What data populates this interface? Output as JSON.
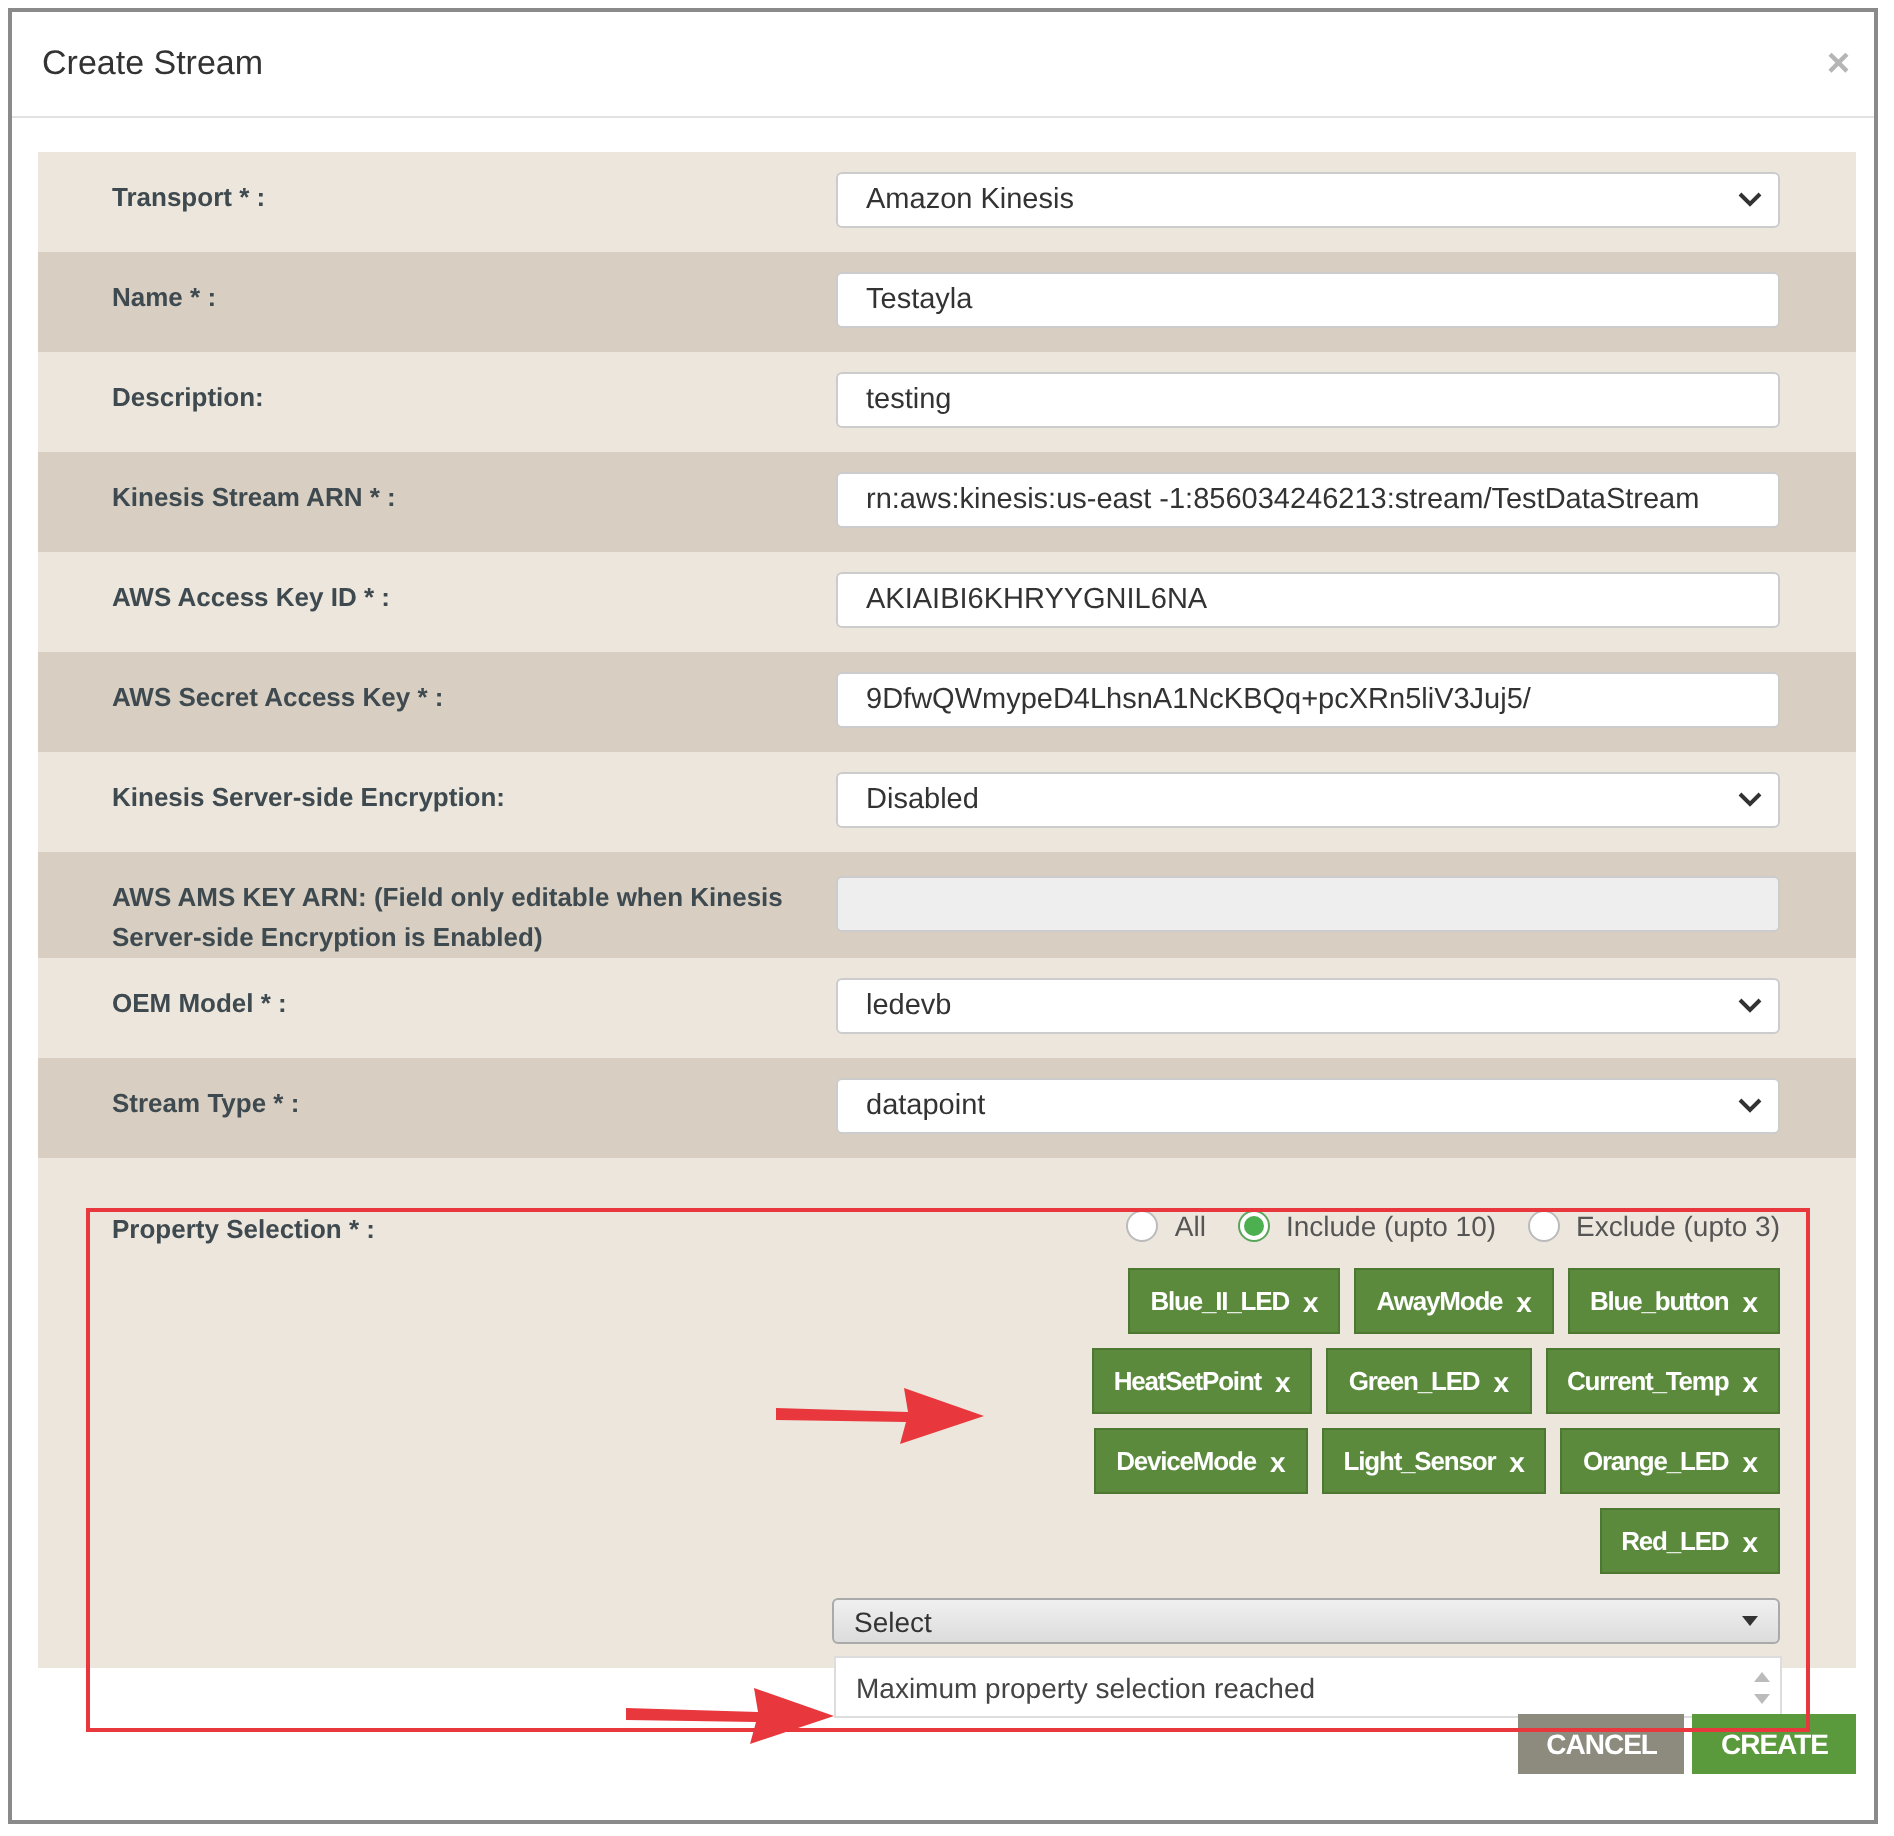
{
  "dialog": {
    "title": "Create Stream",
    "close": "×"
  },
  "fields": [
    {
      "label": "Transport * :",
      "kind": "select",
      "value": "Amazon Kinesis"
    },
    {
      "label": "Name * :",
      "kind": "text",
      "value": "Testayla"
    },
    {
      "label": "Description:",
      "kind": "text",
      "value": "testing"
    },
    {
      "label": "Kinesis Stream ARN * :",
      "kind": "text",
      "value": "rn:aws:kinesis:us-east -1:856034246213:stream/TestDataStream"
    },
    {
      "label": "AWS Access Key ID * :",
      "kind": "text",
      "value": "AKIAIBI6KHRYYGNIL6NA"
    },
    {
      "label": "AWS Secret Access Key * :",
      "kind": "text",
      "value": "9DfwQWmypeD4LhsnA1NcKBQq+pcXRn5liV3Juj5/"
    },
    {
      "label": "Kinesis Server-side Encryption:",
      "kind": "select",
      "value": "Disabled"
    },
    {
      "label": "AWS AMS KEY ARN: (Field only editable when Kinesis Server-side Encryption is Enabled)",
      "kind": "disabled"
    },
    {
      "label": "OEM Model * :",
      "kind": "select",
      "value": "ledevb"
    },
    {
      "label": "Stream Type * :",
      "kind": "select",
      "value": "datapoint"
    }
  ],
  "property_selection": {
    "label": "Property Selection * :",
    "modes": [
      {
        "label": "All",
        "selected": false
      },
      {
        "label": "Include (upto 10)",
        "selected": true
      },
      {
        "label": "Exclude (upto 3)",
        "selected": false
      }
    ],
    "chips": [
      {
        "label": "Blue_II_LED",
        "remove": "x"
      },
      {
        "label": "AwayMode",
        "remove": "x"
      },
      {
        "label": "Blue_button",
        "remove": "x"
      },
      {
        "label": "HeatSetPoint",
        "remove": "x"
      },
      {
        "label": "Green_LED",
        "remove": "x"
      },
      {
        "label": "Current_Temp",
        "remove": "x"
      },
      {
        "label": "DeviceMode",
        "remove": "x"
      },
      {
        "label": "Light_Sensor",
        "remove": "x"
      },
      {
        "label": "Orange_LED",
        "remove": "x"
      },
      {
        "label": "Red_LED",
        "remove": "x"
      }
    ],
    "select": "Select",
    "message": "Maximum property selection reached"
  },
  "buttons": [
    {
      "label": "CANCEL",
      "kind": "secondary"
    },
    {
      "label": "CREATE",
      "kind": "primary"
    }
  ]
}
